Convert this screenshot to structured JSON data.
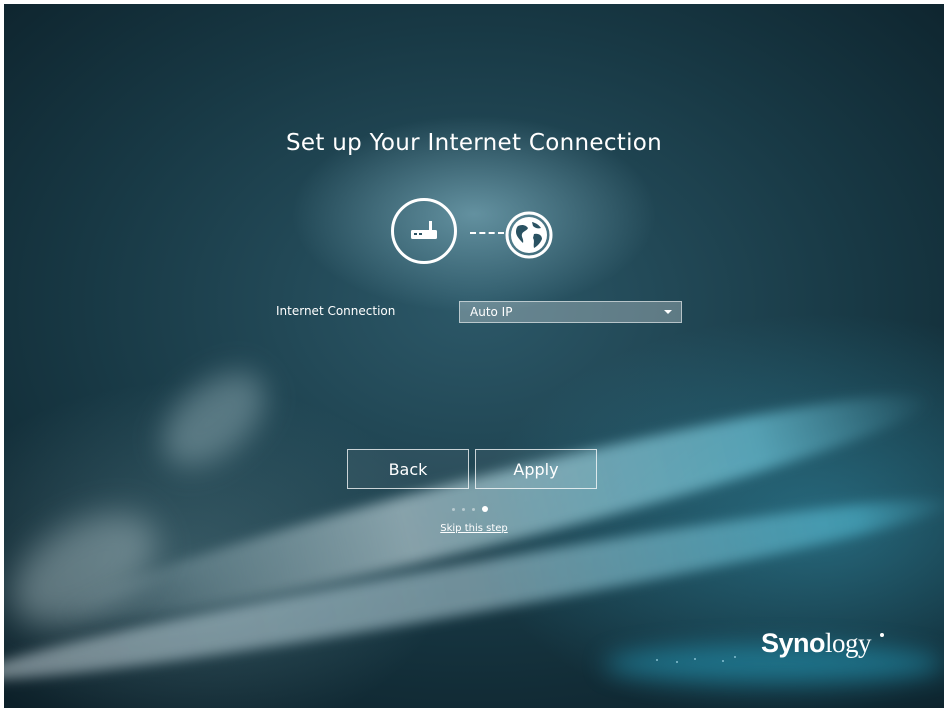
{
  "wizard": {
    "title": "Set up Your Internet Connection",
    "icons": {
      "left": "router-icon",
      "connector": "dashed-line",
      "right": "globe-icon"
    },
    "form": {
      "connection_label": "Internet Connection",
      "connection_value": "Auto IP"
    },
    "buttons": {
      "back_label": "Back",
      "apply_label": "Apply"
    },
    "steps": {
      "total": 4,
      "current": 4
    },
    "skip_label": "Skip this step"
  },
  "brand": {
    "name_bold": "Syno",
    "name_light": "logy"
  },
  "colors": {
    "text": "#ffffff",
    "background_dark": "#183945",
    "accent_glow": "#3cb4d2"
  }
}
